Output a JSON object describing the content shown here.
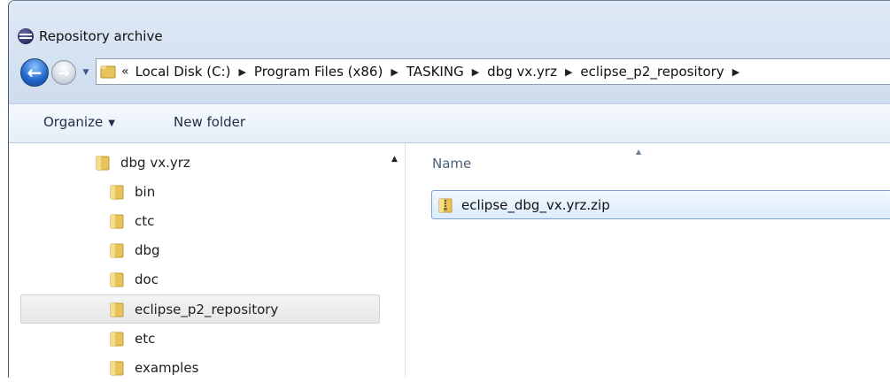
{
  "window": {
    "title": "Repository archive"
  },
  "nav": {
    "back_icon": "back-arrow-icon",
    "forward_icon": "forward-arrow-icon",
    "overflow": "«",
    "breadcrumbs": [
      "Local Disk (C:)",
      "Program Files (x86)",
      "TASKING",
      "dbg vx.yrz",
      "eclipse_p2_repository"
    ]
  },
  "toolbar": {
    "organize_label": "Organize",
    "new_folder_label": "New folder"
  },
  "tree": {
    "items": [
      {
        "label": "dbg vx.yrz",
        "selected": false
      },
      {
        "label": "bin",
        "selected": false
      },
      {
        "label": "ctc",
        "selected": false
      },
      {
        "label": "dbg",
        "selected": false
      },
      {
        "label": "doc",
        "selected": false
      },
      {
        "label": "eclipse_p2_repository",
        "selected": true
      },
      {
        "label": "etc",
        "selected": false
      },
      {
        "label": "examples",
        "selected": false
      }
    ]
  },
  "files": {
    "column_name": "Name",
    "items": [
      {
        "name": "eclipse_dbg_vx.yrz.zip",
        "icon": "zip-folder-icon",
        "selected": true
      }
    ]
  },
  "colors": {
    "folder": "#e8c35a",
    "selection_border": "#7da2ce",
    "accent": "#1f63c6"
  }
}
